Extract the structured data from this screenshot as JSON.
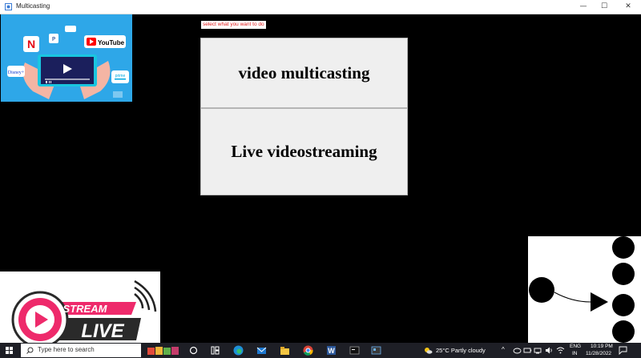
{
  "window": {
    "title": "Multicasting",
    "minimize_glyph": "—",
    "maximize_glyph": "☐",
    "close_glyph": "✕"
  },
  "main": {
    "prompt": "select what you want to do",
    "buttons": [
      {
        "label": "video multicasting"
      },
      {
        "label": "Live videostreaming"
      }
    ]
  },
  "images": {
    "streaming_apps": {
      "brands": [
        "NETFLIX",
        "YouTube",
        "prime video",
        "Disney+"
      ],
      "colors": {
        "background": "#2ea7e8",
        "tablet": "#1b1f5c"
      }
    },
    "live_badge": {
      "line1": "STREAM",
      "line2": "LIVE",
      "colors": {
        "pink": "#ee2a6b",
        "dark": "#2a2a2a"
      }
    },
    "multicast_diagram": {
      "description_shapes": [
        "source-node",
        "arrow",
        "receiver-nodes"
      ]
    }
  },
  "taskbar": {
    "search_placeholder": "Type here to search",
    "weather": "25°C  Partly cloudy",
    "language_line1": "ENG",
    "language_line2": "IN",
    "time": "10:19 PM",
    "date": "11/28/2022",
    "pinned_icons": [
      "widgets-icon",
      "task-view-icon",
      "file-explorer-icon",
      "edge-icon",
      "mail-icon",
      "folder-icon",
      "chrome-icon",
      "word-icon",
      "terminal-icon",
      "python-app-icon"
    ]
  },
  "colors": {
    "accent_red": "#e02020",
    "button_bg": "#efefef",
    "taskbar_bg": "#1e1f26"
  }
}
